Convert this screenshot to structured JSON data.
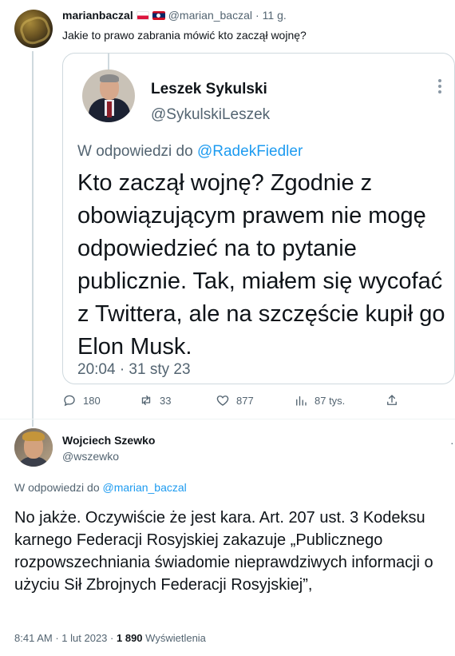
{
  "tweet": {
    "author_name": "marianbaczal",
    "author_handle": "@marian_baczal",
    "separator": "·",
    "time": "11 g.",
    "text": "Jakie to prawo zabrania mówić kto zaczął wojnę?",
    "flags": [
      "poland-flag",
      "laos-flag"
    ],
    "embedded": {
      "name": "Leszek Sykulski",
      "handle": "@SykulskiLeszek",
      "reply_prefix": "W odpowiedzi do",
      "reply_to": "@RadekFiedler",
      "body": "Kto zaczął wojnę? Zgodnie z obowiązującym prawem nie mogę odpowiedzieć na to pytanie publicznie.  Tak, miałem się wycofać z Twittera, ale na szczęście kupił go Elon Musk.",
      "timestamp": "20:04 · 31 sty 23"
    },
    "actions": {
      "replies": "180",
      "retweets": "33",
      "likes": "877",
      "views": "87 tys."
    }
  },
  "reply": {
    "author_name": "Wojciech Szewko",
    "author_handle": "@wszewko",
    "reply_prefix": "W odpowiedzi do",
    "reply_to": "@marian_baczal",
    "body": "No jakże. Oczywiście że jest kara. Art. 207 ust. 3 Kodeksu karnego Federacji Rosyjskiej zakazuje „Publicznego rozpowszechniania świadomie nieprawdziwych informacji o użyciu Sił Zbrojnych Federacji Rosyjskiej”,",
    "time": "8:41 AM",
    "date": "1 lut 2023",
    "views_count": "1 890",
    "views_label": "Wyświetlenia"
  },
  "colors": {
    "accent": "#1d9bf0",
    "muted": "#536471",
    "text": "#0f1419",
    "border": "#cfd9de"
  }
}
